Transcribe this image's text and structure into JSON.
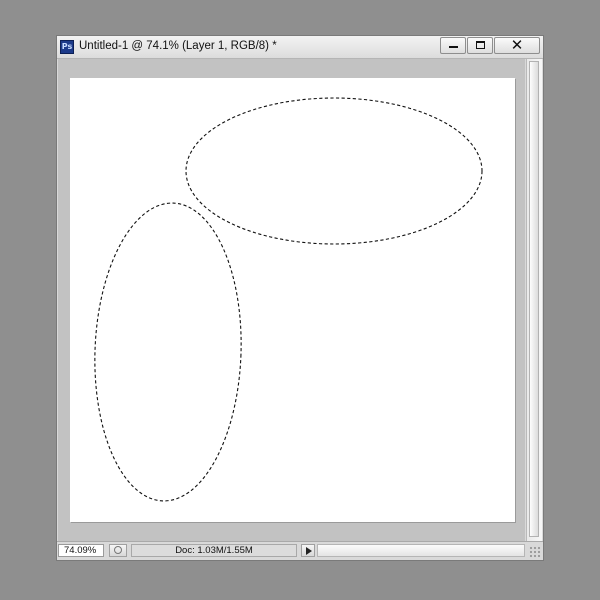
{
  "window": {
    "app_icon": "photoshop-icon",
    "app_icon_text": "Ps",
    "title": "Untitled-1 @ 74.1% (Layer 1, RGB/8) *"
  },
  "controls": {
    "minimize_icon": "minimize-icon",
    "maximize_icon": "maximize-icon",
    "close_icon": "close-icon",
    "close_glyph": "✕"
  },
  "canvas": {
    "background_color": "#ffffff",
    "selections": [
      {
        "name": "horizontal-ellipse-selection"
      },
      {
        "name": "vertical-ellipse-selection"
      }
    ]
  },
  "status": {
    "zoom": "74.09%",
    "doc_info": "Doc: 1.03M/1.55M",
    "menu_arrow_icon": "play-arrow-icon"
  }
}
